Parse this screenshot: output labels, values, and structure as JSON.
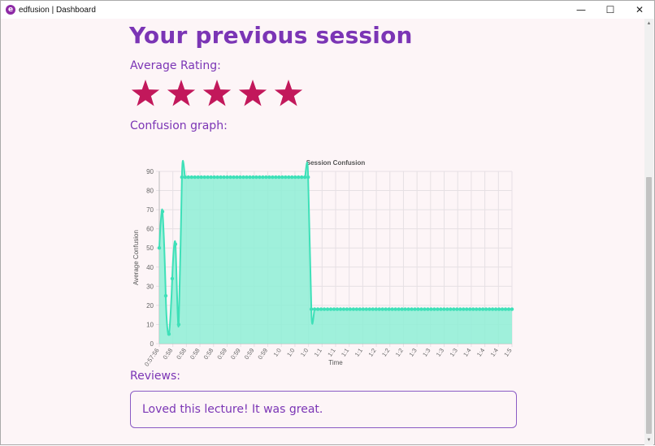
{
  "window": {
    "title": "edfusion | Dashboard",
    "logo_letter": "e",
    "minimize": "—",
    "maximize": "☐",
    "close": "✕"
  },
  "page": {
    "heading": "Your previous session",
    "rating_label": "Average Rating:",
    "rating": 5,
    "rating_max": 5,
    "confusion_label": "Confusion graph:",
    "reviews_label": "Reviews:",
    "reviews": [
      "Loved this lecture! It was great."
    ]
  },
  "colors": {
    "accent": "#7b35b5",
    "star": "#c2185b",
    "line": "#3ee0b8",
    "fill": "#8eefd6"
  },
  "chart_data": {
    "type": "area",
    "title": "Session Confusion",
    "xlabel": "Time",
    "ylabel": "Average Confusion",
    "ylim": [
      0,
      90
    ],
    "yticks": [
      0,
      10,
      20,
      30,
      40,
      50,
      60,
      70,
      80,
      90
    ],
    "x_tick_labels": [
      "0:57:56",
      "0:58",
      "0:58",
      "0:58",
      "0:58",
      "0:59",
      "0:59",
      "0:59",
      "0:59",
      "1:0",
      "1:0",
      "1:0",
      "1:1",
      "1:1",
      "1:1",
      "1:1",
      "1:2",
      "1:2",
      "1:2",
      "1:3",
      "1:3",
      "1:3",
      "1:3",
      "1:4",
      "1:4",
      "1:4",
      "1:5"
    ],
    "series": [
      {
        "values": [
          50,
          69,
          25,
          5,
          34,
          52,
          10,
          87,
          87,
          87,
          87,
          87,
          87,
          87,
          87,
          87,
          87,
          87,
          87,
          87,
          87,
          87,
          87,
          87,
          87,
          87,
          87,
          87,
          87,
          87,
          87,
          87,
          87,
          87,
          87,
          87,
          87,
          87,
          87,
          87,
          87,
          87,
          87,
          87,
          87,
          87,
          87,
          18,
          18,
          18,
          18,
          18,
          18,
          18,
          18,
          18,
          18,
          18,
          18,
          18,
          18,
          18,
          18,
          18,
          18,
          18,
          18,
          18,
          18,
          18,
          18,
          18,
          18,
          18,
          18,
          18,
          18,
          18,
          18,
          18,
          18,
          18,
          18,
          18,
          18,
          18,
          18,
          18,
          18,
          18,
          18,
          18,
          18,
          18,
          18,
          18,
          18,
          18,
          18,
          18,
          18,
          18,
          18,
          18,
          18,
          18,
          18,
          18,
          18,
          18
        ]
      }
    ],
    "grid": true,
    "legend": "none"
  }
}
